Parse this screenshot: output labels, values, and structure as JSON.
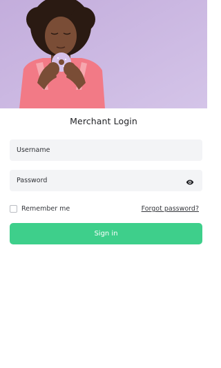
{
  "login": {
    "title": "Merchant Login",
    "username_placeholder": "Username",
    "password_placeholder": "Password",
    "remember_label": "Remember me",
    "remember_checked": false,
    "forgot_label": "Forgot password?",
    "signin_label": "Sign in"
  },
  "icons": {
    "password_toggle": "eye-icon"
  },
  "colors": {
    "primary": "#3ecf8b",
    "field_background": "#f3f4f6",
    "hero_background": "#c9b7e0"
  }
}
